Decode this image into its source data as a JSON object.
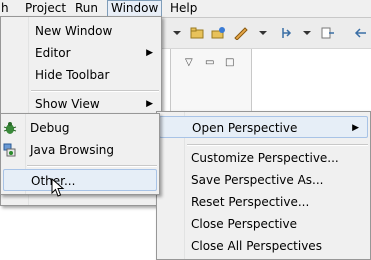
{
  "menubar": {
    "items": [
      "h",
      "Project",
      "Run",
      "Window",
      "Help"
    ]
  },
  "window_menu": {
    "items": [
      {
        "label": "New Window"
      },
      {
        "label": "Editor"
      },
      {
        "label": "Hide Toolbar"
      },
      {
        "label": "Show View"
      }
    ]
  },
  "perspective_menu": {
    "items": [
      {
        "label": "Open Perspective"
      },
      {
        "label": "Customize Perspective..."
      },
      {
        "label": "Save Perspective As..."
      },
      {
        "label": "Reset Perspective..."
      },
      {
        "label": "Close Perspective"
      },
      {
        "label": "Close All Perspectives"
      }
    ]
  },
  "open_perspective_menu": {
    "items": [
      {
        "label": "Debug",
        "icon": "debug-icon"
      },
      {
        "label": "Java Browsing",
        "icon": "java-browsing-icon"
      },
      {
        "label": "Other..."
      }
    ]
  }
}
